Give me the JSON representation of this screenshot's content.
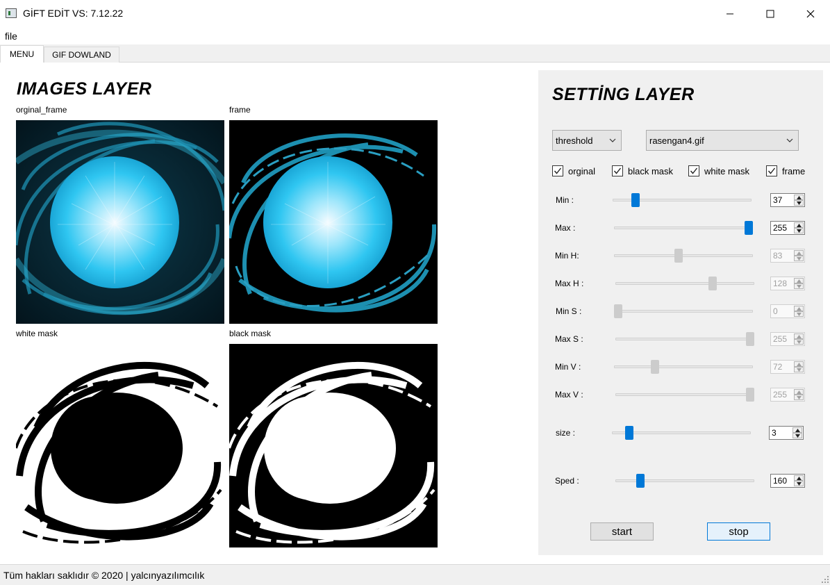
{
  "window": {
    "title": "GİFT EDİT  VS: 7.12.22"
  },
  "menu": {
    "file": "file"
  },
  "tabs": [
    {
      "label": "MENU",
      "active": true
    },
    {
      "label": "GIF DOWLAND",
      "active": false
    }
  ],
  "images": {
    "title": "IMAGES LAYER",
    "panels": [
      {
        "label": "orginal_frame",
        "kind": "original"
      },
      {
        "label": "frame",
        "kind": "frame"
      },
      {
        "label": "white mask",
        "kind": "white-mask"
      },
      {
        "label": "black mask",
        "kind": "black-mask"
      }
    ]
  },
  "settings": {
    "title": "SETTİNG LAYER",
    "mode_select": {
      "value": "threshold"
    },
    "file_select": {
      "value": "rasengan4.gif"
    },
    "checkboxes": [
      {
        "label": "orginal",
        "checked": true
      },
      {
        "label": "black mask",
        "checked": true
      },
      {
        "label": "white mask",
        "checked": true
      },
      {
        "label": "frame",
        "checked": true
      }
    ],
    "sliders": [
      {
        "label": "Min :",
        "value": 37,
        "display": "37",
        "max": 255,
        "enabled": true
      },
      {
        "label": "Max :",
        "value": 255,
        "display": "255",
        "max": 255,
        "enabled": true
      },
      {
        "label": "Min H:",
        "value": 83,
        "display": "83",
        "max": 179,
        "enabled": false
      },
      {
        "label": "Max H :",
        "value": 128,
        "display": "128",
        "max": 179,
        "enabled": false
      },
      {
        "label": "Min S :",
        "value": 0,
        "display": "0",
        "max": 255,
        "enabled": false
      },
      {
        "label": "Max S :",
        "value": 255,
        "display": "255",
        "max": 255,
        "enabled": false
      },
      {
        "label": "Min V :",
        "value": 72,
        "display": "72",
        "max": 255,
        "enabled": false
      },
      {
        "label": "Max V :",
        "value": 255,
        "display": "255",
        "max": 255,
        "enabled": false
      },
      {
        "label": "size :",
        "value": 3,
        "display": "3",
        "max": 30,
        "enabled": true
      },
      {
        "label": "Sped :",
        "value": 160,
        "display": "160",
        "max": 1000,
        "enabled": true
      }
    ],
    "start_label": "start",
    "stop_label": "stop"
  },
  "status": {
    "text": "Tüm hakları saklıdır © 2020 | yalcınyazılımcılık"
  },
  "colors": {
    "accent": "#0078d7",
    "panel_bg": "#f0f0f0",
    "glow": "#37c8f0"
  }
}
